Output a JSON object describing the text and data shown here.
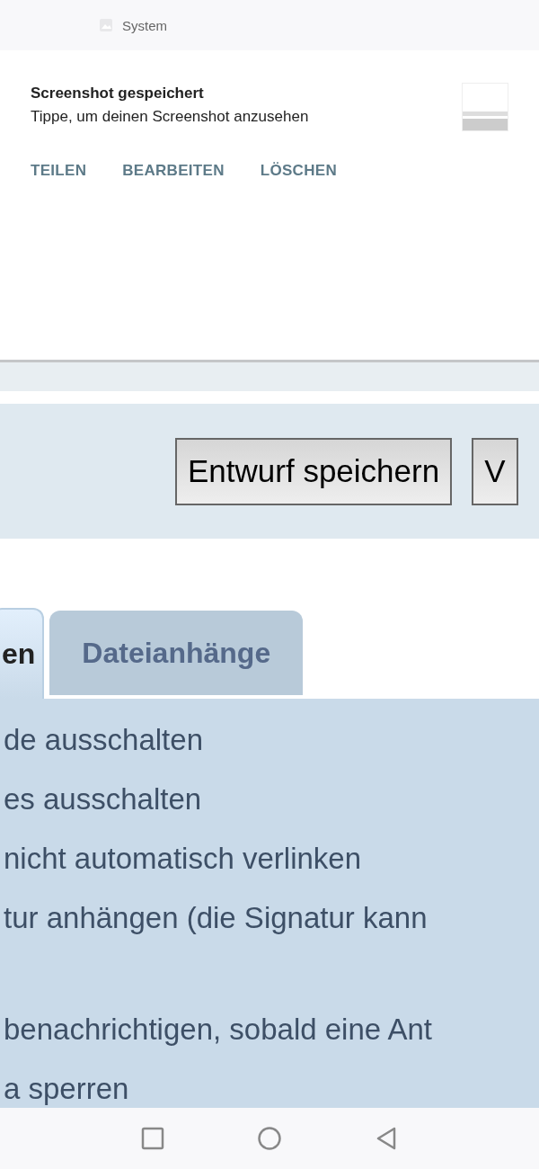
{
  "status_bar": {
    "app_name": "System"
  },
  "notification": {
    "title": "Screenshot gespeichert",
    "text": "Tippe, um deinen Screenshot anzusehen",
    "actions": [
      "TEILEN",
      "BEARBEITEN",
      "LÖSCHEN"
    ]
  },
  "toolbar": {
    "buttons": [
      "Entwurf speichern",
      "V"
    ]
  },
  "tabs": [
    {
      "label": "en",
      "selected": true
    },
    {
      "label": "Dateianhänge",
      "selected": false
    }
  ],
  "option_groups": [
    [
      "de ausschalten",
      "es ausschalten",
      "nicht automatisch verlinken",
      "tur anhängen (die Signatur kann"
    ],
    [
      "benachrichtigen, sobald eine Ant",
      "a sperren"
    ]
  ]
}
